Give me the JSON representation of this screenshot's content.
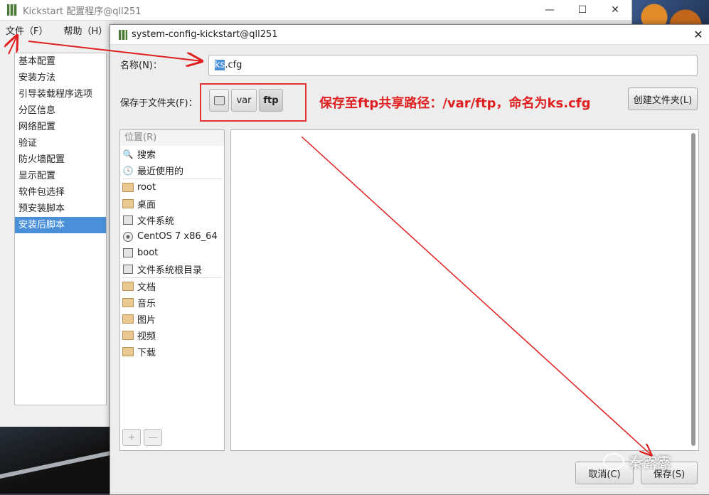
{
  "main_window": {
    "title": "Kickstart 配置程序@qll251",
    "controls": {
      "minimize": "—",
      "maximize": "☐",
      "close": "✕"
    },
    "menu": [
      {
        "label": "文件（F）"
      },
      {
        "label": "帮助（H）"
      }
    ],
    "sidebar": [
      {
        "label": "基本配置"
      },
      {
        "label": "安装方法"
      },
      {
        "label": "引导装载程序选项"
      },
      {
        "label": "分区信息"
      },
      {
        "label": "网络配置"
      },
      {
        "label": "验证"
      },
      {
        "label": "防火墙配置"
      },
      {
        "label": "显示配置"
      },
      {
        "label": "软件包选择"
      },
      {
        "label": "预安装脚本"
      },
      {
        "label": "安装后脚本",
        "selected": true
      }
    ]
  },
  "dialog": {
    "title": "system-config-kickstart@qll251",
    "close": "✕",
    "name_label": "名称(N)：",
    "name_value_selected": "ks",
    "name_value_rest": ".cfg",
    "folder_label": "保存于文件夹(F)：",
    "path_crumbs": [
      "var",
      "ftp"
    ],
    "annotation": "保存至ftp共享路径：/var/ftp，命名为ks.cfg",
    "create_folder_button": "创建文件夹(L)",
    "places_header": "位置(R)",
    "places_groups": [
      [
        {
          "label": "搜索",
          "icon": "search-icon"
        },
        {
          "label": "最近使用的",
          "icon": "clock-icon"
        }
      ],
      [
        {
          "label": "root",
          "icon": "home-folder-icon"
        },
        {
          "label": "桌面",
          "icon": "folder-icon"
        },
        {
          "label": "文件系统",
          "icon": "drive-icon"
        },
        {
          "label": "CentOS 7 x86_64",
          "icon": "disc-icon"
        },
        {
          "label": "boot",
          "icon": "drive-icon"
        },
        {
          "label": "文件系统根目录",
          "icon": "drive-icon"
        }
      ],
      [
        {
          "label": "文档",
          "icon": "folder-icon"
        },
        {
          "label": "音乐",
          "icon": "folder-icon"
        },
        {
          "label": "图片",
          "icon": "folder-icon"
        },
        {
          "label": "视频",
          "icon": "folder-icon"
        },
        {
          "label": "下载",
          "icon": "folder-icon"
        }
      ]
    ],
    "add_place": "+",
    "remove_place": "—",
    "cancel_button": "取消(C)",
    "save_button": "保存(S)"
  },
  "watermark": "秦露露",
  "colors": {
    "annotation": "#e02020",
    "selection": "#4a90d9"
  }
}
